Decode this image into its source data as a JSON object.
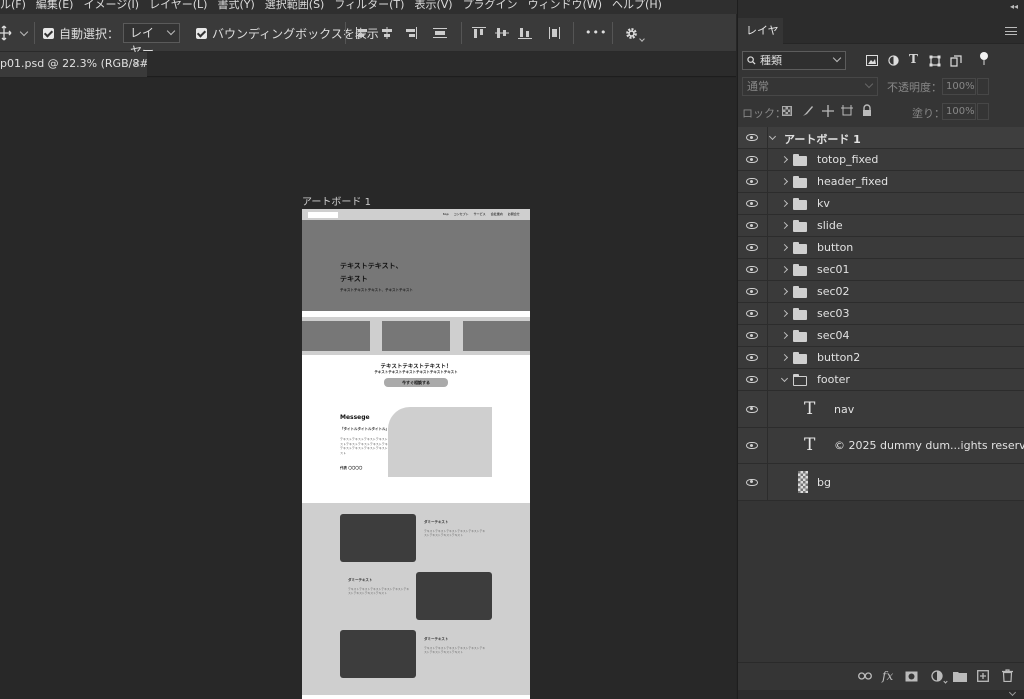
{
  "menubar": {
    "items": [
      "ル(F)",
      "編集(E)",
      "イメージ(I)",
      "レイヤー(L)",
      "書式(Y)",
      "選択範囲(S)",
      "フィルター(T)",
      "表示(V)",
      "プラグイン",
      "ウィンドウ(W)",
      "ヘルプ(H)"
    ]
  },
  "options": {
    "auto_select_label": "自動選択：",
    "auto_select_value": "レイヤー",
    "bounding_box_label": "バウンディングボックスを表示",
    "more_label": "•••"
  },
  "document": {
    "tab_title": "p01.psd @ 22.3% (RGB/8#)",
    "close_glyph": "×"
  },
  "canvas": {
    "artboard_label": "アートボード 1",
    "mock": {
      "nav_items": [
        "top",
        "コンセプト",
        "サービス",
        "会社案内",
        "お問合せ"
      ],
      "hero_line1": "テキストテキスト、",
      "hero_line2": "テキスト",
      "hero_sub": "テキストテキストテキスト、テキストテキスト",
      "cta_title": "テキストテキストテキスト！",
      "cta_sub": "テキストテキストテキストテキストテキストテキスト",
      "cta_button": "今すぐ相談する",
      "message_heading": "Messege",
      "message_subtitle": "「タイトルタイトルタイトル」",
      "message_body": "テキストテキストテキストテキストテキストテキストテキストテキストテキストテキストテキストテキストテキストテキストテキストテキストテキスト",
      "message_sign": "代表 〇〇〇〇",
      "feature_title": "ダミーテキスト",
      "feature_body": "テキストテキストテキストテキストテキストテキストテキストテキストテキスト"
    }
  },
  "panel": {
    "tab_label": "レイヤー",
    "filter_value": "種類",
    "blend_mode": "通常",
    "opacity_label": "不透明度：",
    "opacity_value": "100%",
    "lock_label": "ロック：",
    "fill_label": "塗り：",
    "fill_value": "100%",
    "layers": [
      {
        "name": "アートボード 1",
        "kind": "artboard"
      },
      {
        "name": "totop_fixed",
        "kind": "group"
      },
      {
        "name": "header_fixed",
        "kind": "group"
      },
      {
        "name": "kv",
        "kind": "group"
      },
      {
        "name": "slide",
        "kind": "group"
      },
      {
        "name": "button",
        "kind": "group"
      },
      {
        "name": "sec01",
        "kind": "group"
      },
      {
        "name": "sec02",
        "kind": "group"
      },
      {
        "name": "sec03",
        "kind": "group"
      },
      {
        "name": "sec04",
        "kind": "group"
      },
      {
        "name": "button2",
        "kind": "group"
      },
      {
        "name": "footer",
        "kind": "group-open"
      },
      {
        "name": "nav",
        "kind": "text"
      },
      {
        "name": "© 2025 dummy dum...ights reserved.",
        "kind": "text"
      },
      {
        "name": "bg",
        "kind": "smart"
      }
    ]
  }
}
